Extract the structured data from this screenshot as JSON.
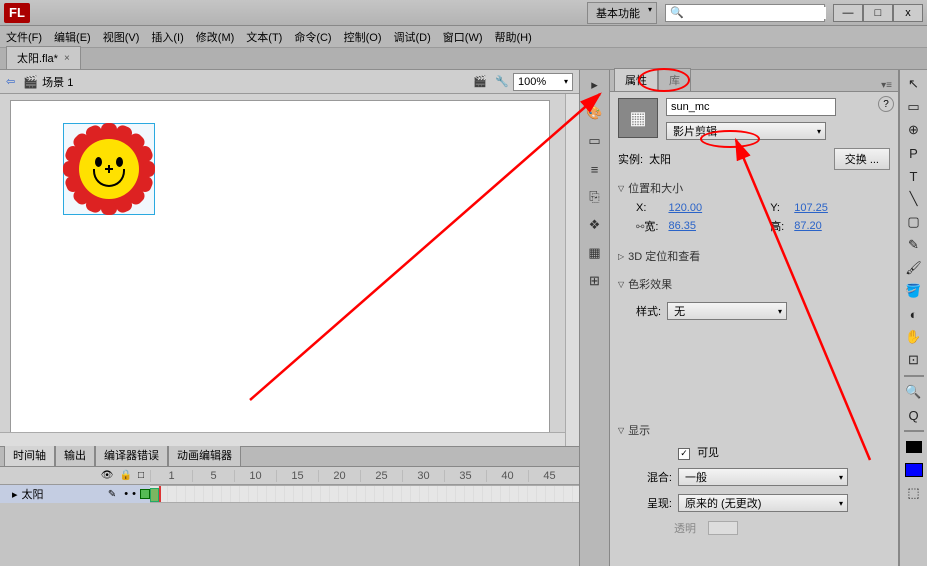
{
  "app": {
    "logo": "FL",
    "workspace": "基本功能",
    "search_placeholder": ""
  },
  "window_controls": {
    "min": "—",
    "max": "□",
    "close": "x"
  },
  "menubar": [
    "文件(F)",
    "编辑(E)",
    "视图(V)",
    "插入(I)",
    "修改(M)",
    "文本(T)",
    "命令(C)",
    "控制(O)",
    "调试(D)",
    "窗口(W)",
    "帮助(H)"
  ],
  "doc_tab": {
    "label": "太阳.fla*",
    "close": "×"
  },
  "scene_bar": {
    "back": "⇦",
    "scene": "场景 1",
    "zoom": "100%"
  },
  "bottom_tabs": [
    "时间轴",
    "输出",
    "编译器错误",
    "动画编辑器"
  ],
  "timeline": {
    "header_icons": [
      "👁",
      "🔒",
      "□"
    ],
    "ruler": [
      "1",
      "5",
      "10",
      "15",
      "20",
      "25",
      "30",
      "35",
      "40",
      "45"
    ],
    "layer": {
      "name": "太阳"
    }
  },
  "mid_icons": [
    "▸",
    "🎨",
    "▭",
    "≡",
    "⎘",
    "❖",
    "▦",
    "⊞"
  ],
  "props": {
    "tab_active": "属性",
    "tab_inactive": "库",
    "instance_name": "sun_mc",
    "type": "影片剪辑",
    "instance_of_label": "实例:",
    "instance_of": "太阳",
    "swap_btn": "交换 ...",
    "sections": {
      "pos": {
        "title": "位置和大小",
        "x_label": "X:",
        "x": "120.00",
        "y_label": "Y:",
        "y": "107.25",
        "w_label": "宽:",
        "w": "86.35",
        "h_label": "高:",
        "h": "87.20"
      },
      "three_d": "3D 定位和查看",
      "color_fx": {
        "title": "色彩效果",
        "style_label": "样式:",
        "style": "无"
      },
      "display": {
        "title": "显示",
        "visible_label": "可见",
        "blend_label": "混合:",
        "blend": "一般",
        "render_label": "呈现:",
        "render": "原来的 (无更改)",
        "transparent": "透明"
      }
    }
  },
  "toolbox": [
    "↖",
    "▭",
    "⊕",
    "P",
    "T",
    "╲",
    "▢",
    "✎",
    "🖌",
    "🪣",
    "◐",
    "✋",
    "⊡",
    "🔍",
    "Q",
    "⬚"
  ]
}
